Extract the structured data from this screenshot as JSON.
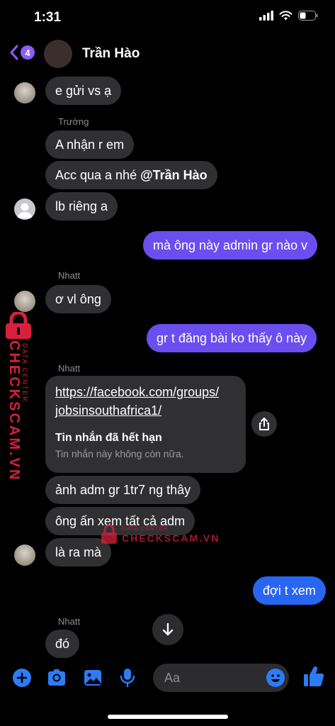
{
  "status_bar": {
    "time": "1:31"
  },
  "header": {
    "back_count": "4",
    "contact_name": "Trần Hào"
  },
  "messages": {
    "m1": "e gửi vs ạ",
    "sender_truong": "Trường",
    "m2": "A nhận r em",
    "m3_prefix": "Acc qua a nhé ",
    "m3_mention": "@Trần Hào",
    "m4": "lb riêng a",
    "m5": "mà ông này admin gr nào v",
    "sender_nhatt_1": "Nhatt",
    "m6": "ơ vl ông",
    "m7": "gr t đăng bài ko thấy ô này",
    "sender_nhatt_2": "Nhatt",
    "link_url_line1": "https://facebook.com/groups/",
    "link_url_line2": "jobsinsouthafrica1/",
    "link_title": "Tin nhắn đã hết hạn",
    "link_subtitle": "Tin nhắn này không còn nữa.",
    "m8": "ảnh adm gr 1tr7 ng thây",
    "m9": "ông ấn xem tất cả adm",
    "m10": "là ra mà",
    "m11": "đợi t xem",
    "sender_nhatt_3": "Nhatt",
    "m12": "đó"
  },
  "composer": {
    "placeholder": "Aa"
  },
  "watermark": {
    "brand": "CHECKSCAM.VN",
    "tag": "DATA CENTER"
  },
  "colors": {
    "outgoing_purple": "#6b4ef0",
    "outgoing_blue": "#2866f2",
    "incoming": "#303033",
    "accent_icon": "#2d7cf6",
    "watermark_red": "#d8203c"
  }
}
